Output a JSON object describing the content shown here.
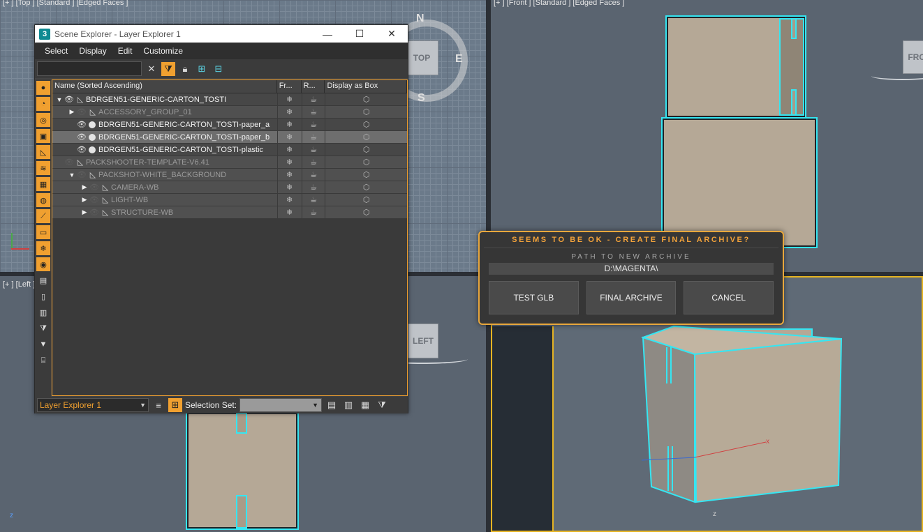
{
  "viewports": {
    "top_label": "[+ ] [Top ] [Standard ] [Edged Faces ]",
    "front_label": "[+ ] [Front ] [Standard ] [Edged Faces ]",
    "left_label": "[+ ] [Left ]",
    "viewcube_top": "TOP",
    "viewcube_front": "FRO",
    "viewcube_left": "LEFT",
    "compass": {
      "n": "N",
      "e": "E",
      "s": "S"
    },
    "axis_x": "x",
    "axis_z": "z",
    "active_border_color": "#e6b422",
    "selection_color": "#35e6f2"
  },
  "explorer": {
    "title": "Scene Explorer - Layer Explorer 1",
    "app_icon": "3",
    "window_buttons": {
      "minimize": "—",
      "maximize": "☐",
      "close": "✕"
    },
    "menu": [
      "Select",
      "Display",
      "Edit",
      "Customize"
    ],
    "search_placeholder": "",
    "columns": {
      "name": "Name (Sorted Ascending)",
      "frozen": "Fr...",
      "render": "R...",
      "box": "Display as Box"
    },
    "rows": [
      {
        "name": "BDRGEN51-GENERIC-CARTON_TOSTI",
        "indent": 0,
        "arrow": "▼",
        "eye": true,
        "type": "layer",
        "dim": false,
        "selected": false
      },
      {
        "name": "ACCESSORY_GROUP_01",
        "indent": 1,
        "arrow": "▶",
        "eye": false,
        "type": "layer",
        "dim": true,
        "selected": false
      },
      {
        "name": "BDRGEN51-GENERIC-CARTON_TOSTI-paper_a",
        "indent": 1,
        "arrow": "",
        "eye": true,
        "type": "object",
        "dim": false,
        "selected": false
      },
      {
        "name": "BDRGEN51-GENERIC-CARTON_TOSTI-paper_b",
        "indent": 1,
        "arrow": "",
        "eye": true,
        "type": "object",
        "dim": false,
        "selected": true
      },
      {
        "name": "BDRGEN51-GENERIC-CARTON_TOSTI-plastic",
        "indent": 1,
        "arrow": "",
        "eye": true,
        "type": "object",
        "dim": false,
        "selected": false
      },
      {
        "name": "PACKSHOOTER-TEMPLATE-V6.41",
        "indent": 0,
        "arrow": "",
        "eye": false,
        "type": "layer",
        "dim": true,
        "selected": false
      },
      {
        "name": "PACKSHOT-WHITE_BACKGROUND",
        "indent": 1,
        "arrow": "▼",
        "eye": false,
        "type": "layer",
        "dim": true,
        "selected": false
      },
      {
        "name": "CAMERA-WB",
        "indent": 2,
        "arrow": "▶",
        "eye": false,
        "type": "layer",
        "dim": true,
        "selected": false
      },
      {
        "name": "LIGHT-WB",
        "indent": 2,
        "arrow": "▶",
        "eye": false,
        "type": "layer",
        "dim": true,
        "selected": false
      },
      {
        "name": "STRUCTURE-WB",
        "indent": 2,
        "arrow": "▶",
        "eye": false,
        "type": "layer",
        "dim": true,
        "selected": false
      }
    ],
    "status": {
      "layer_dropdown": "Layer Explorer 1",
      "selection_set_label": "Selection Set:",
      "selection_set_value": ""
    }
  },
  "dialog": {
    "title": "SEEMS TO BE OK - CREATE FINAL ARCHIVE?",
    "path_label": "PATH TO NEW ARCHIVE",
    "path_value": "D:\\MAGENTA\\",
    "buttons": {
      "test": "TEST GLB",
      "final": "FINAL ARCHIVE",
      "cancel": "CANCEL"
    }
  }
}
